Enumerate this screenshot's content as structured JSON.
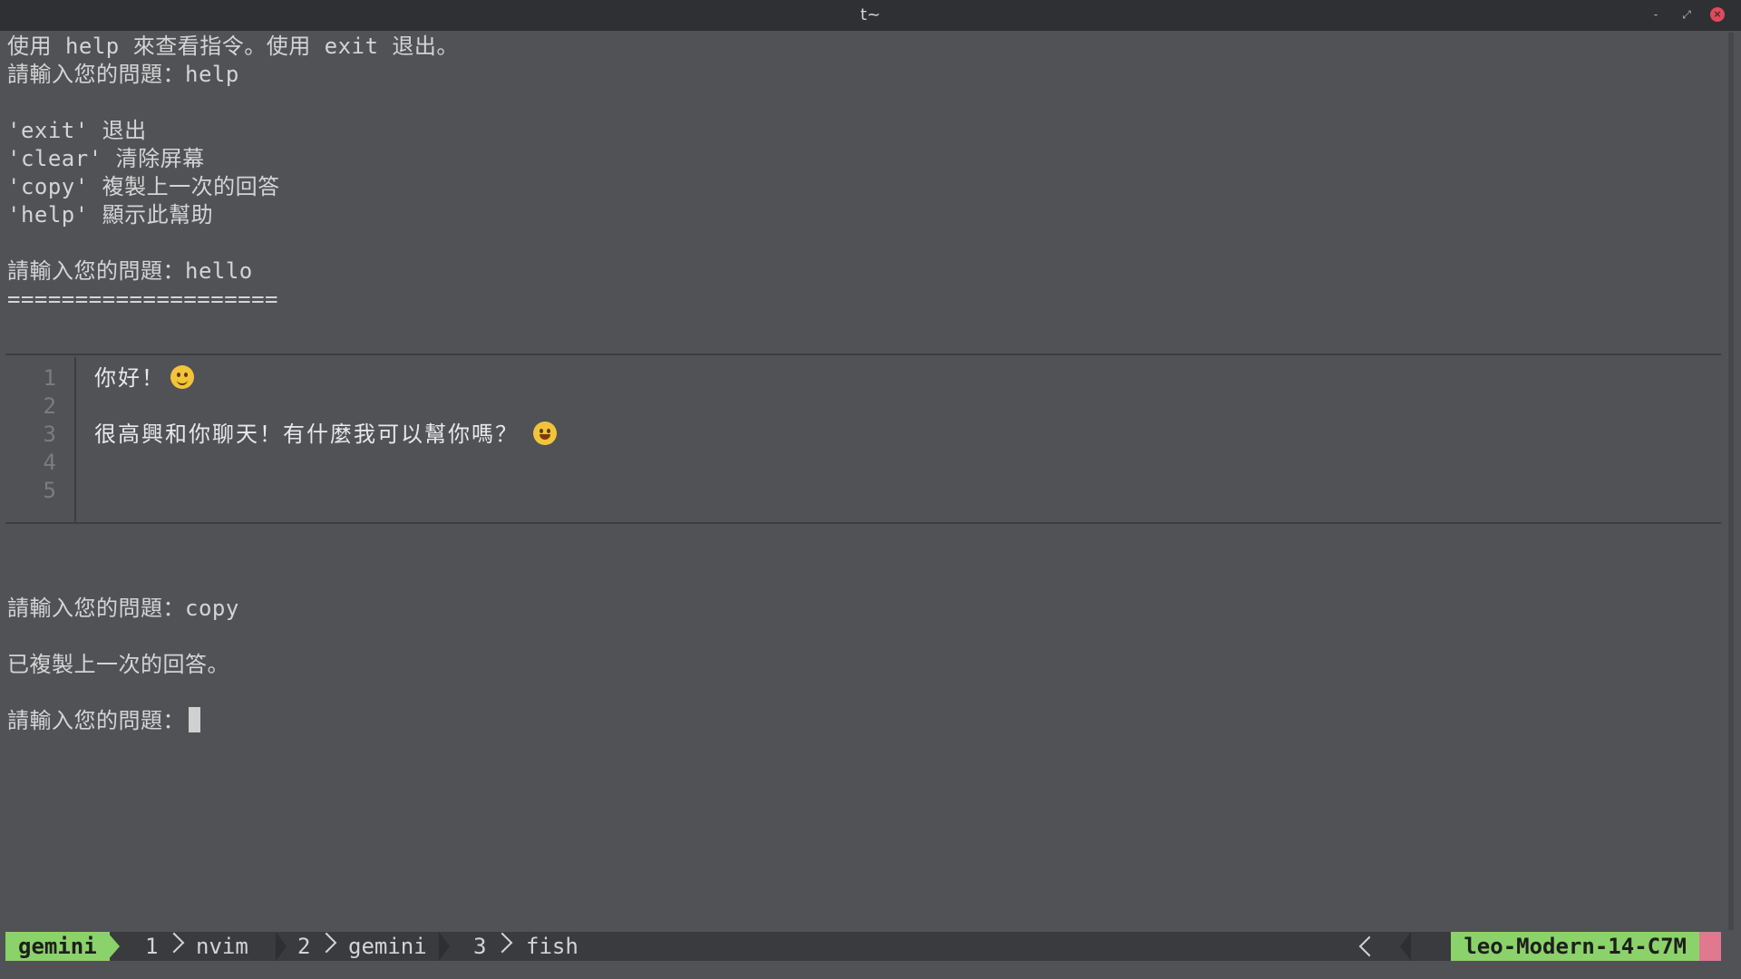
{
  "window": {
    "title": "t~",
    "minimize_glyph": "‐",
    "maximize_glyph": "⤢",
    "close_glyph": "×"
  },
  "terminal": {
    "lines": [
      "使用 help 來查看指令。使用 exit 退出。",
      "請輸入您的問題：help",
      "",
      "'exit' 退出",
      "'clear' 清除屏幕",
      "'copy' 複製上一次的回答",
      "'help' 顯示此幫助",
      "",
      "請輸入您的問題：hello",
      "===================="
    ],
    "nvim_lines": [
      {
        "num": "1",
        "text": "你好！"
      },
      {
        "num": "2",
        "text": ""
      },
      {
        "num": "3",
        "text": "很高興和你聊天！有什麼我可以幫你嗎？"
      },
      {
        "num": "4",
        "text": ""
      },
      {
        "num": "5",
        "text": ""
      }
    ],
    "after_lines": [
      "請輸入您的問題：copy",
      "",
      "已複製上一次的回答。",
      ""
    ],
    "prompt": "請輸入您的問題："
  },
  "statusbar": {
    "session": "gemini",
    "windows": [
      {
        "index": "1",
        "name": "nvim"
      },
      {
        "index": "2",
        "name": "gemini"
      },
      {
        "index": "3",
        "name": "fish"
      }
    ],
    "host": "leo-Modern-14-C7M"
  },
  "colors": {
    "accent_green": "#8bd26a",
    "accent_pink": "#e07890",
    "background": "#505256"
  }
}
